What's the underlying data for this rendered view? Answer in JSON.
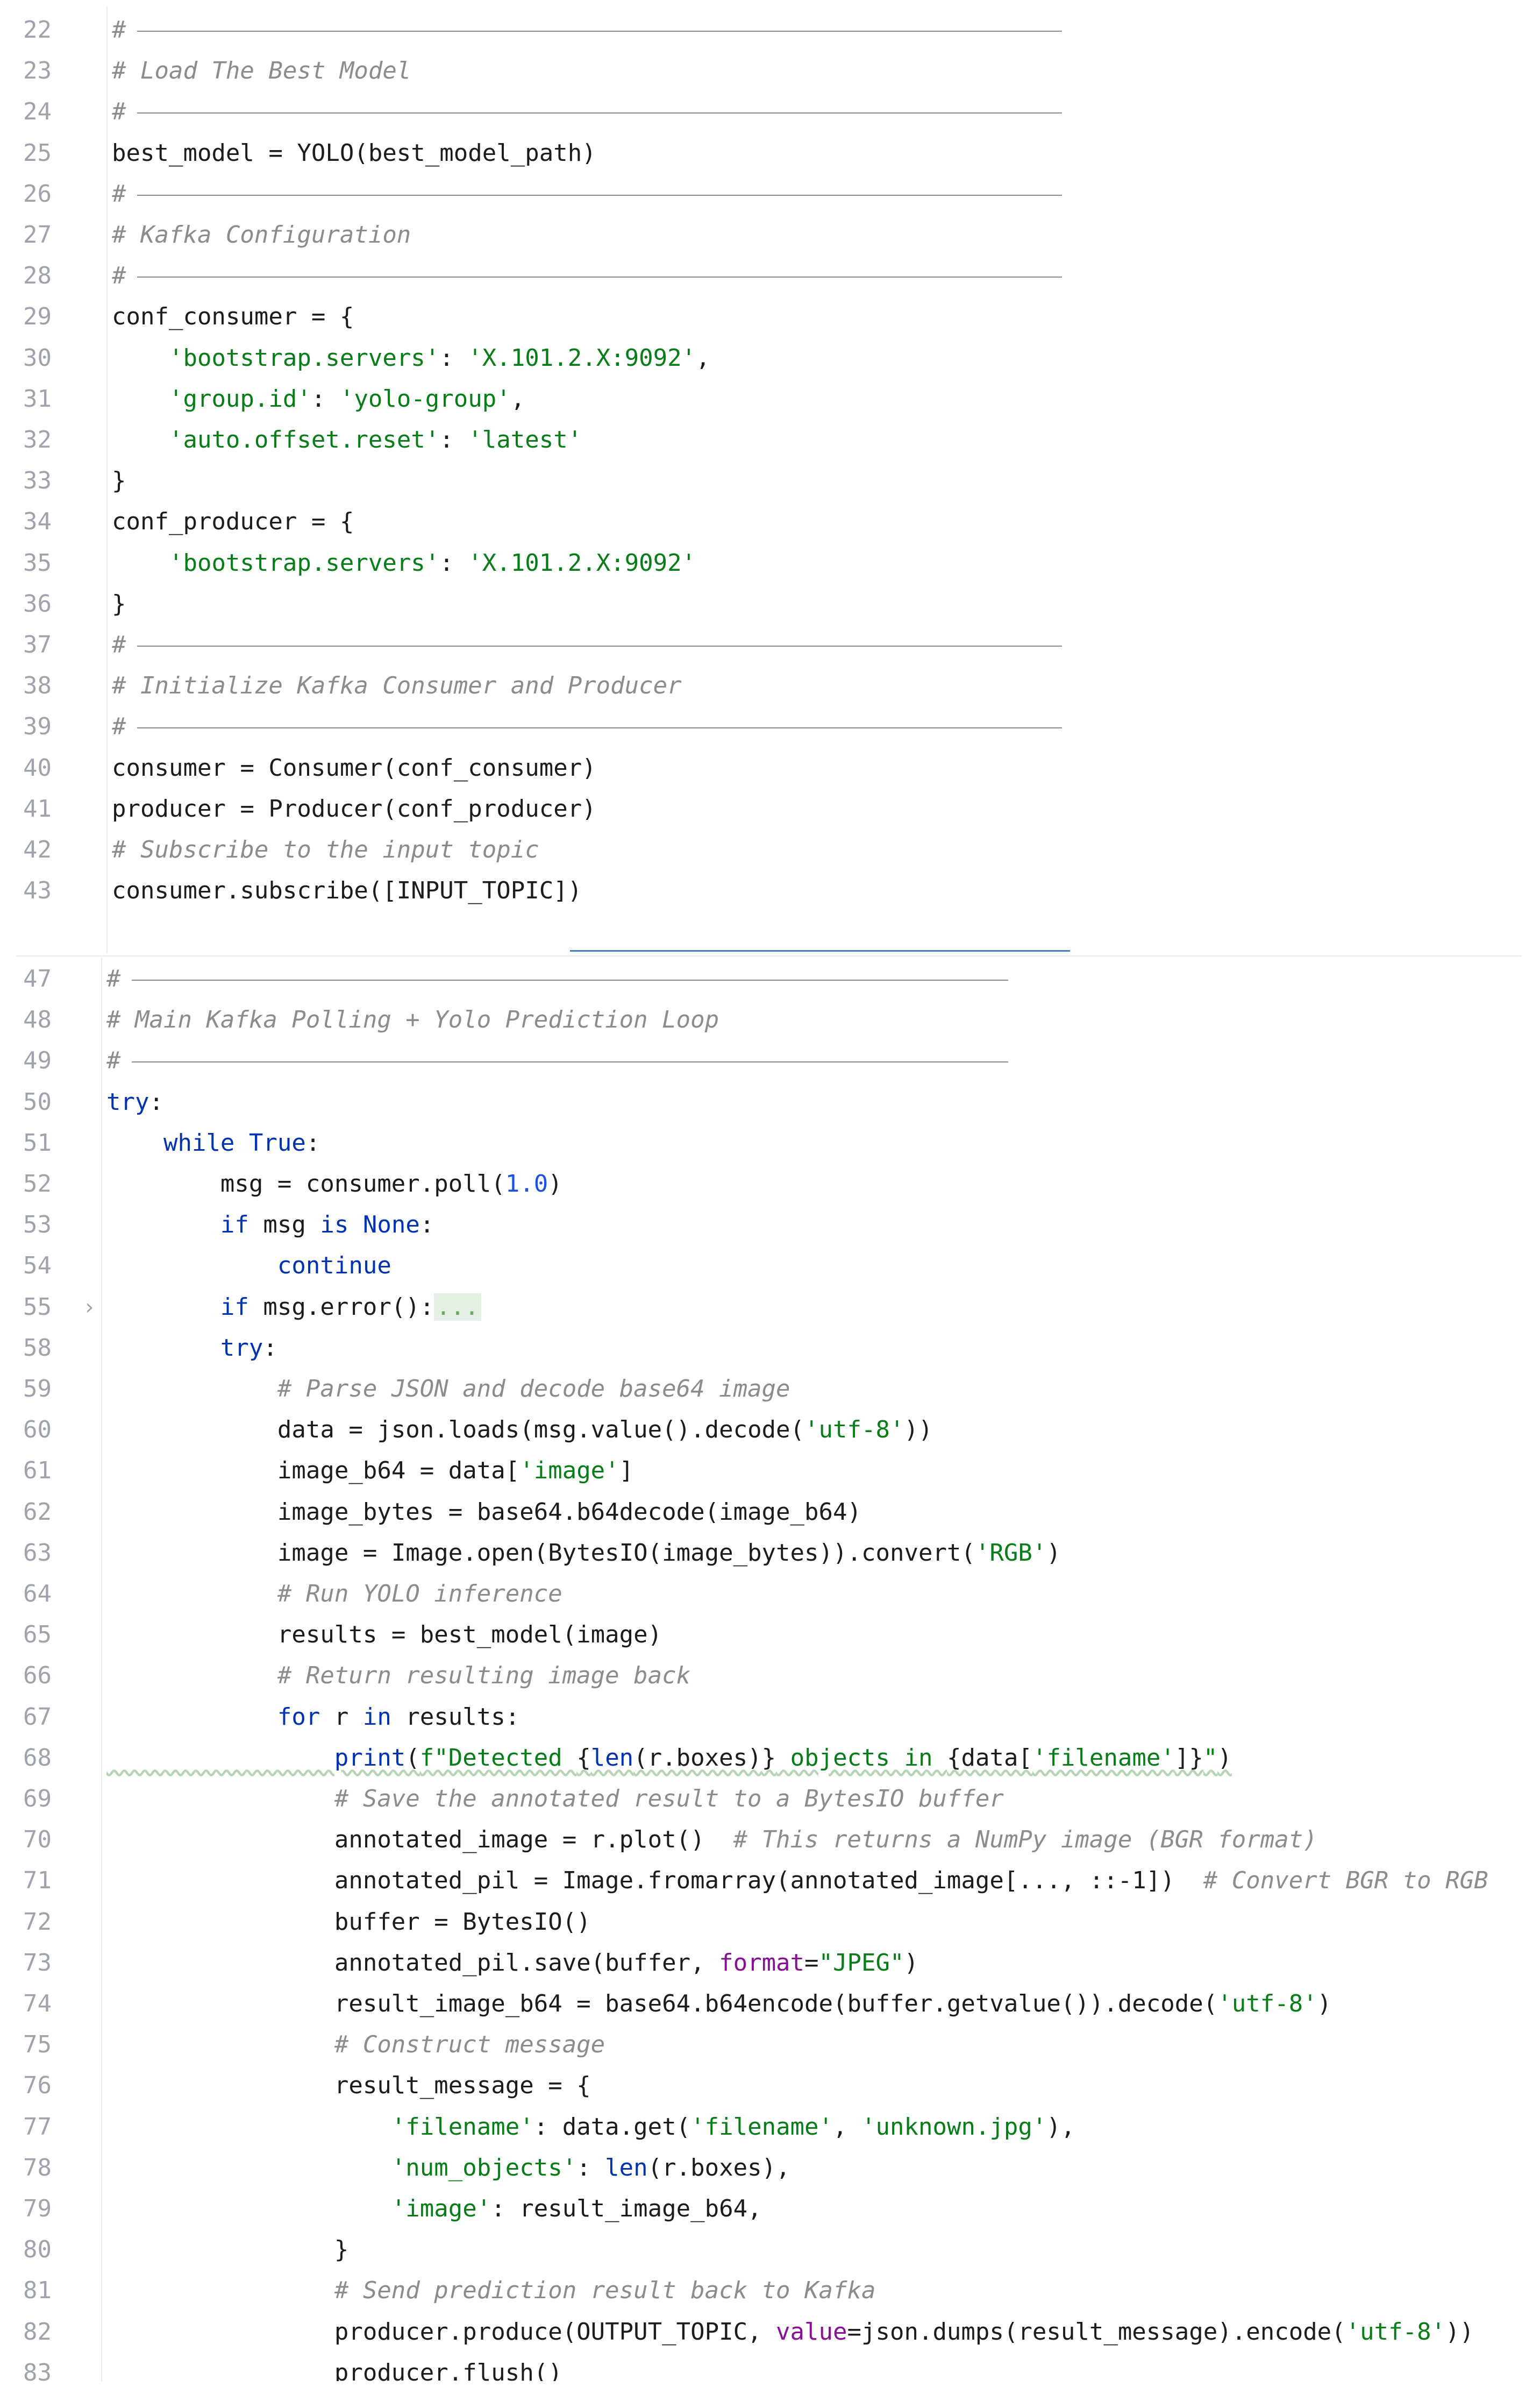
{
  "editor": {
    "top_pane": [
      {
        "ln": "22",
        "t": "sep"
      },
      {
        "ln": "23",
        "t": "comment",
        "text": "# Load The Best Model"
      },
      {
        "ln": "24",
        "t": "sep"
      },
      {
        "ln": "25",
        "t": "code",
        "indent": 0,
        "parts": [
          [
            "",
            "best_model = YOLO(best_model_path)"
          ]
        ]
      },
      {
        "ln": "26",
        "t": "sep"
      },
      {
        "ln": "27",
        "t": "comment",
        "text": "# Kafka Configuration"
      },
      {
        "ln": "28",
        "t": "sep"
      },
      {
        "ln": "29",
        "t": "code",
        "indent": 0,
        "parts": [
          [
            "",
            "conf_consumer = {"
          ]
        ]
      },
      {
        "ln": "30",
        "t": "code",
        "indent": 1,
        "parts": [
          [
            "s",
            "'bootstrap.servers'"
          ],
          [
            "",
            ": "
          ],
          [
            "s",
            "'X.101.2.X:9092'"
          ],
          [
            "",
            ","
          ]
        ]
      },
      {
        "ln": "31",
        "t": "code",
        "indent": 1,
        "parts": [
          [
            "s",
            "'group.id'"
          ],
          [
            "",
            ": "
          ],
          [
            "s",
            "'yolo-group'"
          ],
          [
            "",
            ","
          ]
        ]
      },
      {
        "ln": "32",
        "t": "code",
        "indent": 1,
        "parts": [
          [
            "s",
            "'auto.offset.reset'"
          ],
          [
            "",
            ": "
          ],
          [
            "s",
            "'latest'"
          ]
        ]
      },
      {
        "ln": "33",
        "t": "code",
        "indent": 0,
        "parts": [
          [
            "",
            "}"
          ]
        ]
      },
      {
        "ln": "34",
        "t": "code",
        "indent": 0,
        "parts": [
          [
            "",
            "conf_producer = {"
          ]
        ]
      },
      {
        "ln": "35",
        "t": "code",
        "indent": 1,
        "parts": [
          [
            "s",
            "'bootstrap.servers'"
          ],
          [
            "",
            ": "
          ],
          [
            "s",
            "'X.101.2.X:9092'"
          ]
        ]
      },
      {
        "ln": "36",
        "t": "code",
        "indent": 0,
        "parts": [
          [
            "",
            "}"
          ]
        ]
      },
      {
        "ln": "37",
        "t": "sep"
      },
      {
        "ln": "38",
        "t": "comment",
        "text": "# Initialize Kafka Consumer and Producer"
      },
      {
        "ln": "39",
        "t": "sep"
      },
      {
        "ln": "40",
        "t": "code",
        "indent": 0,
        "parts": [
          [
            "",
            "consumer = Consumer(conf_consumer)"
          ]
        ]
      },
      {
        "ln": "41",
        "t": "code",
        "indent": 0,
        "parts": [
          [
            "",
            "producer = Producer(conf_producer)"
          ]
        ]
      },
      {
        "ln": "42",
        "t": "comment",
        "text": "# Subscribe to the input topic"
      },
      {
        "ln": "43",
        "t": "code",
        "indent": 0,
        "parts": [
          [
            "",
            "consumer.subscribe([INPUT_TOPIC])"
          ]
        ]
      }
    ],
    "bottom_pane": [
      {
        "ln": "47",
        "t": "sep"
      },
      {
        "ln": "48",
        "t": "comment",
        "text": "# Main Kafka Polling + Yolo Prediction Loop"
      },
      {
        "ln": "49",
        "t": "sep"
      },
      {
        "ln": "50",
        "t": "code",
        "indent": 0,
        "parts": [
          [
            "k",
            "try"
          ],
          [
            "",
            ":"
          ]
        ]
      },
      {
        "ln": "51",
        "t": "code",
        "indent": 1,
        "parts": [
          [
            "k",
            "while"
          ],
          [
            "",
            " "
          ],
          [
            "k",
            "True"
          ],
          [
            "",
            ":"
          ]
        ]
      },
      {
        "ln": "52",
        "t": "code",
        "indent": 2,
        "parts": [
          [
            "",
            "msg = consumer.poll("
          ],
          [
            "n",
            "1.0"
          ],
          [
            "",
            ")"
          ]
        ]
      },
      {
        "ln": "53",
        "t": "code",
        "indent": 2,
        "parts": [
          [
            "k",
            "if"
          ],
          [
            "",
            " msg "
          ],
          [
            "k",
            "is"
          ],
          [
            "",
            " "
          ],
          [
            "k",
            "None"
          ],
          [
            "",
            ":"
          ]
        ]
      },
      {
        "ln": "54",
        "t": "code",
        "indent": 3,
        "parts": [
          [
            "k",
            "continue"
          ]
        ]
      },
      {
        "ln": "55",
        "t": "code",
        "indent": 2,
        "fold": true,
        "parts": [
          [
            "k",
            "if"
          ],
          [
            "",
            " msg.error():"
          ],
          [
            "fold",
            "..."
          ]
        ]
      },
      {
        "ln": "58",
        "t": "code",
        "indent": 2,
        "parts": [
          [
            "k",
            "try"
          ],
          [
            "",
            ":"
          ]
        ]
      },
      {
        "ln": "59",
        "t": "code",
        "indent": 3,
        "parts": [
          [
            "c",
            "# Parse JSON and decode base64 image"
          ]
        ]
      },
      {
        "ln": "60",
        "t": "code",
        "indent": 3,
        "parts": [
          [
            "",
            "data = json.loads(msg.value().decode("
          ],
          [
            "s",
            "'utf-8'"
          ],
          [
            "",
            "))"
          ]
        ]
      },
      {
        "ln": "61",
        "t": "code",
        "indent": 3,
        "parts": [
          [
            "",
            "image_b64 = data["
          ],
          [
            "s",
            "'image'"
          ],
          [
            "",
            "]"
          ]
        ]
      },
      {
        "ln": "62",
        "t": "code",
        "indent": 3,
        "parts": [
          [
            "",
            "image_bytes = base64.b64decode(image_b64)"
          ]
        ]
      },
      {
        "ln": "63",
        "t": "code",
        "indent": 3,
        "parts": [
          [
            "",
            "image = Image.open(BytesIO(image_bytes)).convert("
          ],
          [
            "s",
            "'RGB'"
          ],
          [
            "",
            ")"
          ]
        ]
      },
      {
        "ln": "64",
        "t": "code",
        "indent": 3,
        "parts": [
          [
            "c",
            "# Run YOLO inference"
          ]
        ]
      },
      {
        "ln": "65",
        "t": "code",
        "indent": 3,
        "parts": [
          [
            "",
            "results = best_model(image)"
          ]
        ]
      },
      {
        "ln": "66",
        "t": "code",
        "indent": 3,
        "parts": [
          [
            "c",
            "# Return resulting image back"
          ]
        ]
      },
      {
        "ln": "67",
        "t": "code",
        "indent": 3,
        "parts": [
          [
            "k",
            "for"
          ],
          [
            "",
            " r "
          ],
          [
            "k",
            "in"
          ],
          [
            "",
            " results:"
          ]
        ]
      },
      {
        "ln": "68",
        "t": "code",
        "indent": 4,
        "parts": [
          [
            "b",
            "print"
          ],
          [
            "",
            "("
          ],
          [
            "s",
            "f\"Detected "
          ],
          [
            "",
            "{"
          ],
          [
            "b",
            "len"
          ],
          [
            "",
            "(r.boxes)"
          ],
          [
            "",
            "}"
          ],
          [
            "s",
            " objects in "
          ],
          [
            "",
            "{data["
          ],
          [
            "s",
            "'filename'"
          ],
          [
            "",
            "]}"
          ],
          [
            "s",
            "\""
          ],
          [
            "",
            ")"
          ]
        ]
      },
      {
        "ln": "69",
        "t": "code",
        "indent": 4,
        "parts": [
          [
            "c",
            "# Save the annotated result to a BytesIO buffer"
          ]
        ]
      },
      {
        "ln": "70",
        "t": "code",
        "indent": 4,
        "parts": [
          [
            "",
            "annotated_image = r.plot()  "
          ],
          [
            "c",
            "# This returns a NumPy image (BGR format)"
          ]
        ]
      },
      {
        "ln": "71",
        "t": "code",
        "indent": 4,
        "parts": [
          [
            "",
            "annotated_pil = Image.fromarray(annotated_image[..., ::-1])  "
          ],
          [
            "c",
            "# Convert BGR to RGB"
          ]
        ]
      },
      {
        "ln": "72",
        "t": "code",
        "indent": 4,
        "parts": [
          [
            "",
            "buffer = BytesIO()"
          ]
        ]
      },
      {
        "ln": "73",
        "t": "code",
        "indent": 4,
        "parts": [
          [
            "",
            "annotated_pil.save(buffer, "
          ],
          [
            "p",
            "format"
          ],
          [
            "",
            "="
          ],
          [
            "s",
            "\"JPEG\""
          ],
          [
            "",
            ")"
          ]
        ]
      },
      {
        "ln": "74",
        "t": "code",
        "indent": 4,
        "parts": [
          [
            "",
            "result_image_b64 = base64.b64encode(buffer.getvalue()).decode("
          ],
          [
            "s",
            "'utf-8'"
          ],
          [
            "",
            ")"
          ]
        ]
      },
      {
        "ln": "75",
        "t": "code",
        "indent": 4,
        "parts": [
          [
            "c",
            "# Construct message"
          ]
        ]
      },
      {
        "ln": "76",
        "t": "code",
        "indent": 4,
        "parts": [
          [
            "",
            "result_message = {"
          ]
        ]
      },
      {
        "ln": "77",
        "t": "code",
        "indent": 5,
        "parts": [
          [
            "s",
            "'filename'"
          ],
          [
            "",
            ": data.get("
          ],
          [
            "s",
            "'filename'"
          ],
          [
            "",
            ", "
          ],
          [
            "s",
            "'unknown.jpg'"
          ],
          [
            "",
            "),"
          ]
        ]
      },
      {
        "ln": "78",
        "t": "code",
        "indent": 5,
        "parts": [
          [
            "s",
            "'num_objects'"
          ],
          [
            "",
            ": "
          ],
          [
            "b",
            "len"
          ],
          [
            "",
            "(r.boxes),"
          ]
        ]
      },
      {
        "ln": "79",
        "t": "code",
        "indent": 5,
        "parts": [
          [
            "s",
            "'image'"
          ],
          [
            "",
            ": result_image_b64,"
          ]
        ]
      },
      {
        "ln": "80",
        "t": "code",
        "indent": 4,
        "parts": [
          [
            "",
            "}"
          ]
        ]
      },
      {
        "ln": "81",
        "t": "code",
        "indent": 4,
        "parts": [
          [
            "c",
            "# Send prediction result back to Kafka"
          ]
        ]
      },
      {
        "ln": "82",
        "t": "code",
        "indent": 4,
        "parts": [
          [
            "",
            "producer.produce(OUTPUT_TOPIC, "
          ],
          [
            "p",
            "value"
          ],
          [
            "",
            "=json.dumps(result_message).encode("
          ],
          [
            "s",
            "'utf-8'"
          ],
          [
            "",
            "))"
          ]
        ]
      },
      {
        "ln": "83",
        "t": "code",
        "indent": 4,
        "parts": [
          [
            "",
            "producer.flush()"
          ]
        ]
      }
    ],
    "separator_text": "#"
  }
}
